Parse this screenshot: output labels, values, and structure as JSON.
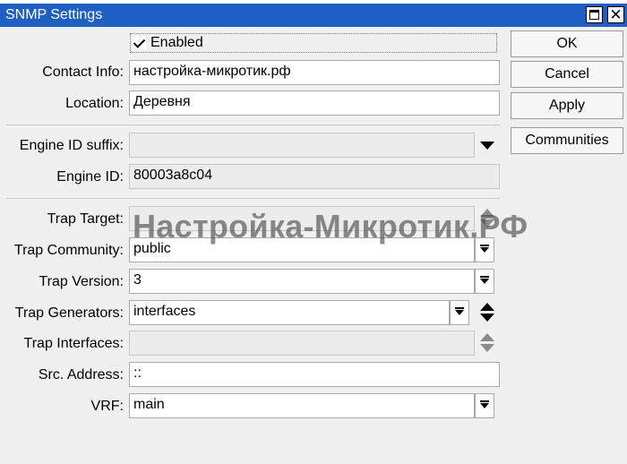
{
  "window": {
    "title": "SNMP Settings",
    "top_text": "",
    "title_bar_color": "#1f5fc3"
  },
  "form": {
    "enabled": {
      "label": "Enabled",
      "checked": true
    },
    "contact_info": {
      "label": "Contact Info:",
      "value": "настройка-микротик.рф"
    },
    "location": {
      "label": "Location:",
      "value": "Деревня"
    },
    "engine_id_suffix": {
      "label": "Engine ID suffix:",
      "value": ""
    },
    "engine_id": {
      "label": "Engine ID:",
      "value": "80003a8c04"
    },
    "trap_target": {
      "label": "Trap Target:",
      "value": ""
    },
    "trap_community": {
      "label": "Trap Community:",
      "value": "public"
    },
    "trap_version": {
      "label": "Trap Version:",
      "value": "3"
    },
    "trap_generators": {
      "label": "Trap Generators:",
      "value": "interfaces"
    },
    "trap_interfaces": {
      "label": "Trap Interfaces:",
      "value": ""
    },
    "src_address": {
      "label": "Src. Address:",
      "value": "::"
    },
    "vrf": {
      "label": "VRF:",
      "value": "main"
    }
  },
  "buttons": {
    "ok": "OK",
    "cancel": "Cancel",
    "apply": "Apply",
    "communities": "Communities"
  },
  "watermark": "Настройка-Микротик.РФ",
  "icons": {
    "maximize": "maximize-icon",
    "close": "close-icon",
    "dropdown": "dropdown-arrow-icon",
    "select": "select-arrow-icon",
    "updown": "up-down-arrows-icon"
  }
}
